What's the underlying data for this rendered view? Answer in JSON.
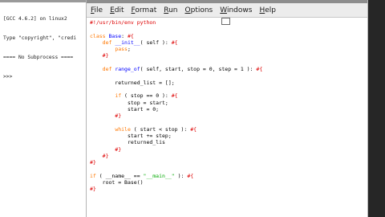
{
  "shell": {
    "lines": [
      "[GCC 4.6.2] on linux2",
      "Type \"copyright\", \"credi",
      "==== No Subprocess ====",
      ">>>"
    ]
  },
  "menu": [
    {
      "u": "F",
      "rest": "ile"
    },
    {
      "u": "E",
      "rest": "dit"
    },
    {
      "u": "F",
      "rest": "ormat",
      "pre": ""
    },
    {
      "u": "R",
      "rest": "un"
    },
    {
      "u": "O",
      "rest": "ptions"
    },
    {
      "u": "W",
      "rest": "indows"
    },
    {
      "u": "H",
      "rest": "elp"
    }
  ],
  "code": [
    [
      {
        "t": "#!/usr/bin/env python",
        "c": "comment"
      }
    ],
    [],
    [
      {
        "t": "class ",
        "c": "keyword"
      },
      {
        "t": "Base",
        "c": "def"
      },
      {
        "t": ": ",
        "c": "plain"
      },
      {
        "t": "#{",
        "c": "comment"
      }
    ],
    [
      {
        "t": "    ",
        "c": "plain"
      },
      {
        "t": "def ",
        "c": "keyword"
      },
      {
        "t": "__init__",
        "c": "def"
      },
      {
        "t": "( self ): ",
        "c": "plain"
      },
      {
        "t": "#{",
        "c": "comment"
      }
    ],
    [
      {
        "t": "        ",
        "c": "plain"
      },
      {
        "t": "pass",
        "c": "keyword"
      },
      {
        "t": ";",
        "c": "plain"
      }
    ],
    [
      {
        "t": "    #}",
        "c": "comment"
      }
    ],
    [],
    [
      {
        "t": "    ",
        "c": "plain"
      },
      {
        "t": "def ",
        "c": "keyword"
      },
      {
        "t": "range_of",
        "c": "def"
      },
      {
        "t": "( self, start, stop = 0, step = 1 ): ",
        "c": "plain"
      },
      {
        "t": "#{",
        "c": "comment"
      }
    ],
    [],
    [
      {
        "t": "        returned_list = [];",
        "c": "plain"
      }
    ],
    [],
    [
      {
        "t": "        ",
        "c": "plain"
      },
      {
        "t": "if",
        "c": "keyword"
      },
      {
        "t": " ( stop ",
        "c": "plain"
      },
      {
        "t": "== 0 ): ",
        "c": "plain"
      },
      {
        "t": "#{",
        "c": "comment"
      }
    ],
    [
      {
        "t": "            stop = start;",
        "c": "plain"
      }
    ],
    [
      {
        "t": "            start = 0;",
        "c": "plain"
      }
    ],
    [
      {
        "t": "        #}",
        "c": "comment"
      }
    ],
    [],
    [
      {
        "t": "        ",
        "c": "plain"
      },
      {
        "t": "while",
        "c": "keyword"
      },
      {
        "t": " ( start < stop ): ",
        "c": "plain"
      },
      {
        "t": "#{",
        "c": "comment"
      }
    ],
    [
      {
        "t": "            start += step;",
        "c": "plain"
      }
    ],
    [
      {
        "t": "            returned_lis",
        "c": "plain"
      }
    ],
    [
      {
        "t": "        #}",
        "c": "comment"
      }
    ],
    [
      {
        "t": "    #}",
        "c": "comment"
      }
    ],
    [
      {
        "t": "#}",
        "c": "comment"
      }
    ],
    [],
    [
      {
        "t": "if",
        "c": "keyword"
      },
      {
        "t": " ( __name__ == ",
        "c": "plain"
      },
      {
        "t": "\"__main__\"",
        "c": "string"
      },
      {
        "t": " ): ",
        "c": "plain"
      },
      {
        "t": "#{",
        "c": "comment"
      }
    ],
    [
      {
        "t": "    root = Base()",
        "c": "plain"
      }
    ],
    [
      {
        "t": "#}",
        "c": "comment"
      }
    ]
  ]
}
